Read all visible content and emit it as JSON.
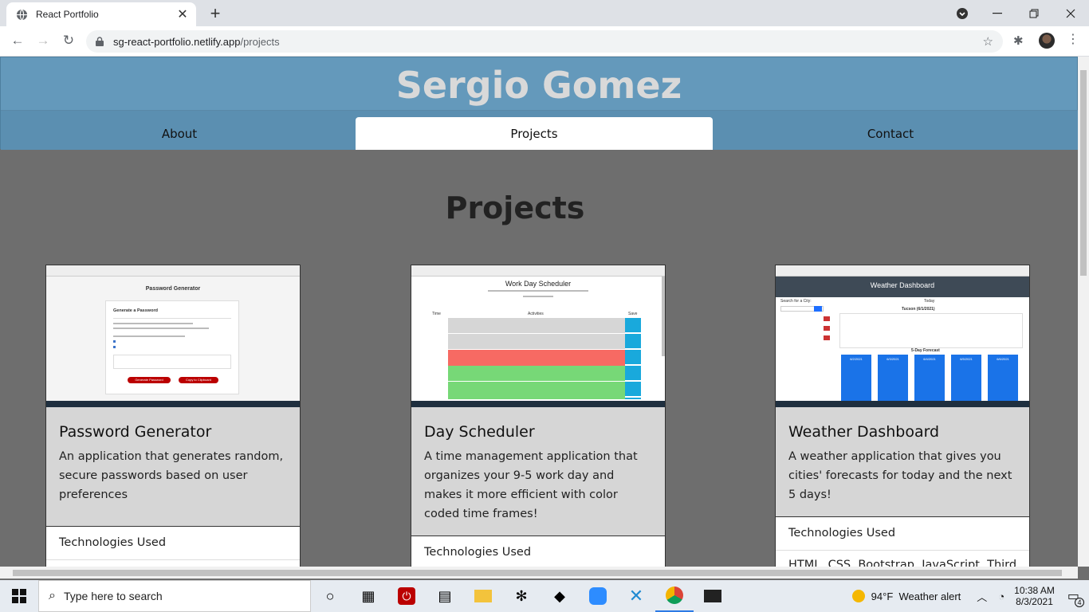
{
  "browser": {
    "tab_title": "React Portfolio",
    "url_host": "sg-react-portfolio.netlify.app",
    "url_path": "/projects",
    "new_tab": "+",
    "close_tab": "✕"
  },
  "header": {
    "name": "Sergio Gomez"
  },
  "nav": {
    "items": [
      {
        "label": "About"
      },
      {
        "label": "Projects"
      },
      {
        "label": "Contact"
      }
    ],
    "active": "Projects"
  },
  "page": {
    "title": "Projects"
  },
  "projects": [
    {
      "title": "Password Generator",
      "description": "An application that generates random, secure passwords based on user preferences",
      "tech_label": "Technologies Used",
      "shot": {
        "heading": "Password Generator",
        "sub": "Generate a Password",
        "btn1": "Generate Password",
        "btn2": "Copy to Clipboard"
      }
    },
    {
      "title": "Day Scheduler",
      "description": "A time management application that organizes your 9-5 work day and makes it more efficient with color coded time frames!",
      "tech_label": "Technologies Used",
      "shot": {
        "heading": "Work Day Scheduler",
        "col_time": "Time",
        "col_act": "Activities",
        "col_save": "Save"
      }
    },
    {
      "title": "Weather Dashboard",
      "description": "A weather application that gives you cities' forecasts for today and the next 5 days!",
      "tech_label": "Technologies Used",
      "tech_list": "HTML, CSS, Bootstrap, JavaScript, Third",
      "shot": {
        "heading": "Weather Dashboard",
        "search": "Search for a City:",
        "today": "Today",
        "city": "Tucson (6/1/2021)",
        "forecast": "5-Day Forecast",
        "days": [
          "6/2/2021",
          "6/3/2021",
          "6/4/2021",
          "6/5/2021",
          "6/6/2021"
        ]
      }
    }
  ],
  "taskbar": {
    "search_placeholder": "Type here to search",
    "weather": "94°F  Weather alert",
    "time": "10:38 AM",
    "date": "8/3/2021",
    "notifications": "4"
  }
}
